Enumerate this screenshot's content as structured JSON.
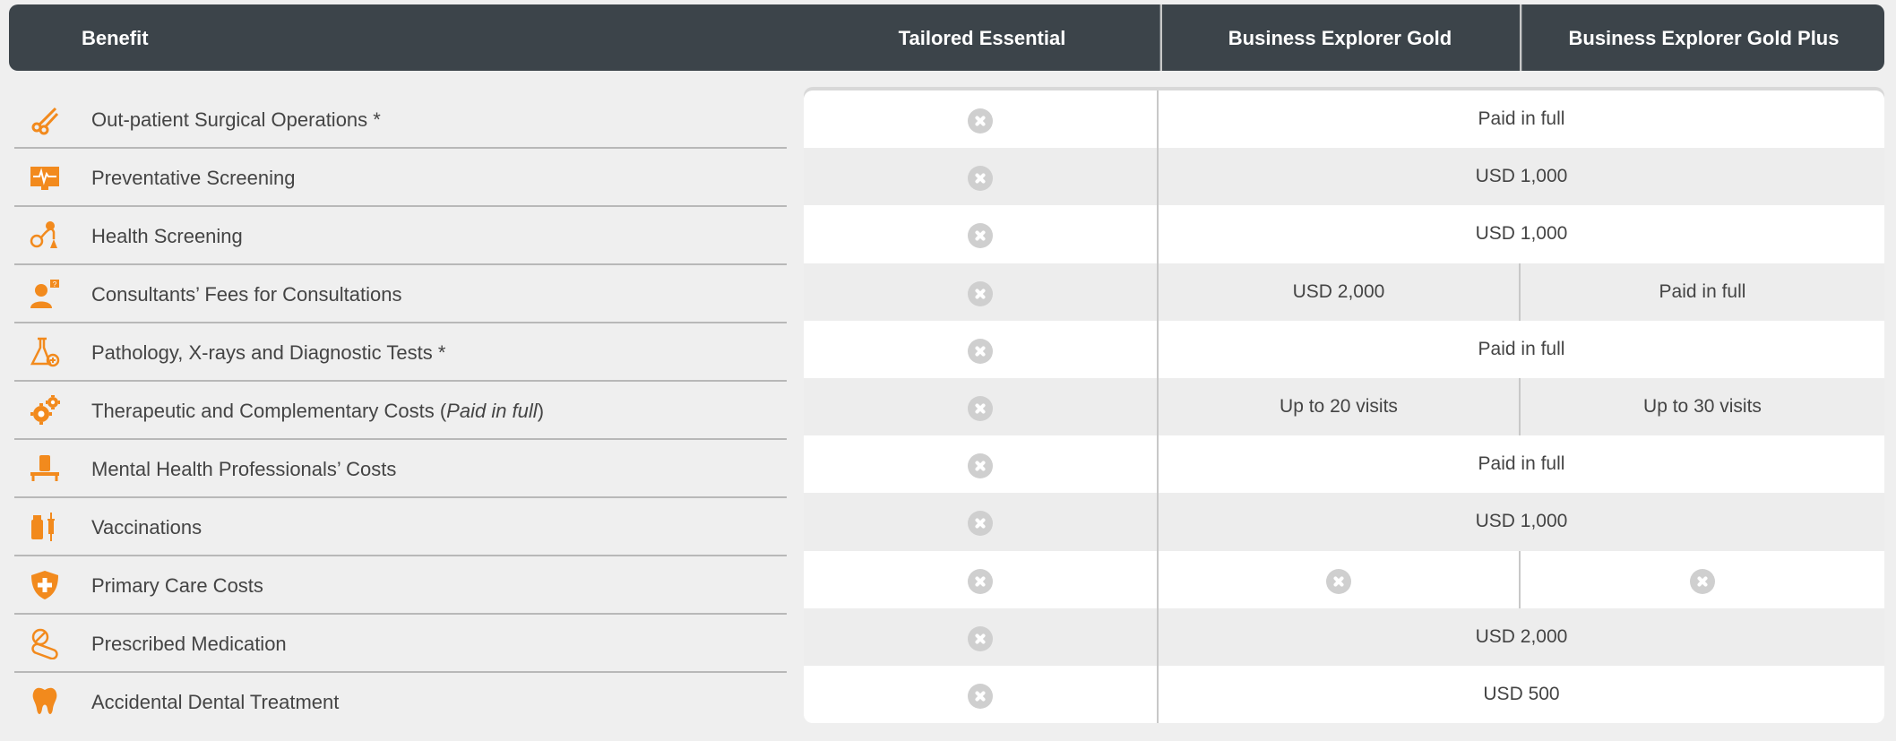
{
  "header": {
    "benefit": "Benefit",
    "col1": "Tailored Essential",
    "col2": "Business Explorer Gold",
    "col3": "Business Explorer Gold Plus"
  },
  "accent_color": "#f28a1d",
  "rows": [
    {
      "label": "Out-patient Surgical Operations *",
      "icon": "scissors-icon",
      "c1": "not-covered",
      "c23": "Paid in full"
    },
    {
      "label": "Preventative Screening",
      "icon": "monitor-icon",
      "c1": "not-covered",
      "c23": "USD 1,000"
    },
    {
      "label": "Health Screening",
      "icon": "stethoscope-icon",
      "c1": "not-covered",
      "c23": "USD 1,000"
    },
    {
      "label": "Consultants’ Fees for Consultations",
      "icon": "doctor-icon",
      "c1": "not-covered",
      "c2": "USD 2,000",
      "c3": "Paid in full"
    },
    {
      "label": "Pathology, X-rays and Diagnostic Tests *",
      "icon": "flask-icon",
      "c1": "not-covered",
      "c23": "Paid in full"
    },
    {
      "label_main": "Therapeutic and Complementary Costs (",
      "label_italic": "Paid in full",
      "label_end": ")",
      "icon": "gears-icon",
      "c1": "not-covered",
      "c2": "Up to 20 visits",
      "c3": "Up to 30 visits"
    },
    {
      "label": "Mental Health Professionals’ Costs",
      "icon": "couch-icon",
      "c1": "not-covered",
      "c23": "Paid in full"
    },
    {
      "label": "Vaccinations",
      "icon": "syringe-icon",
      "c1": "not-covered",
      "c23": "USD 1,000"
    },
    {
      "label": "Primary Care Costs",
      "icon": "shield-icon",
      "c1": "not-covered",
      "c2": "not-covered",
      "c3": "not-covered"
    },
    {
      "label": "Prescribed Medication",
      "icon": "pills-icon",
      "c1": "not-covered",
      "c23": "USD 2,000"
    },
    {
      "label": "Accidental Dental Treatment",
      "icon": "tooth-icon",
      "c1": "not-covered",
      "c23": "USD 500"
    }
  ]
}
